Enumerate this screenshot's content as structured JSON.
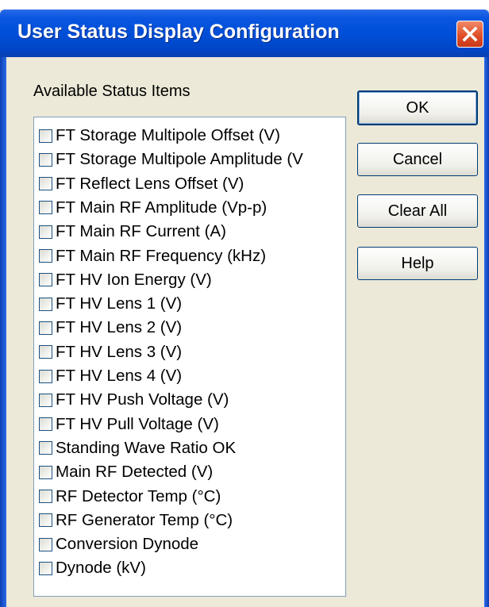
{
  "window": {
    "title": "User Status Display Configuration"
  },
  "list": {
    "label": "Available Status Items",
    "items": [
      {
        "label": "FT Storage Multipole Offset (V)",
        "checked": false
      },
      {
        "label": "FT Storage Multipole Amplitude (V",
        "checked": false
      },
      {
        "label": "FT Reflect Lens Offset (V)",
        "checked": false
      },
      {
        "label": "FT Main RF Amplitude (Vp-p)",
        "checked": false
      },
      {
        "label": "FT Main RF Current (A)",
        "checked": false
      },
      {
        "label": "FT Main RF Frequency (kHz)",
        "checked": false
      },
      {
        "label": "FT HV Ion Energy (V)",
        "checked": false
      },
      {
        "label": "FT HV Lens 1 (V)",
        "checked": false
      },
      {
        "label": "FT HV Lens 2 (V)",
        "checked": false
      },
      {
        "label": "FT HV Lens 3 (V)",
        "checked": false
      },
      {
        "label": "FT HV Lens 4 (V)",
        "checked": false
      },
      {
        "label": "FT HV Push Voltage (V)",
        "checked": false
      },
      {
        "label": "FT HV Pull Voltage (V)",
        "checked": false
      },
      {
        "label": "Standing Wave Ratio OK",
        "checked": false
      },
      {
        "label": "Main RF Detected (V)",
        "checked": false
      },
      {
        "label": "RF Detector Temp (°C)",
        "checked": false
      },
      {
        "label": "RF Generator Temp (°C)",
        "checked": false
      },
      {
        "label": "Conversion Dynode",
        "checked": false
      },
      {
        "label": "Dynode (kV)",
        "checked": false
      }
    ]
  },
  "buttons": {
    "ok": "OK",
    "cancel": "Cancel",
    "clear_all": "Clear All",
    "help": "Help"
  },
  "icons": {
    "close": "close-icon",
    "scroll_up": "chevron-up-icon",
    "scroll_down": "chevron-down-icon"
  },
  "colors": {
    "titlebar": "#0a56e0",
    "dialog_bg": "#ece9d8",
    "close_button": "#e0502a"
  }
}
